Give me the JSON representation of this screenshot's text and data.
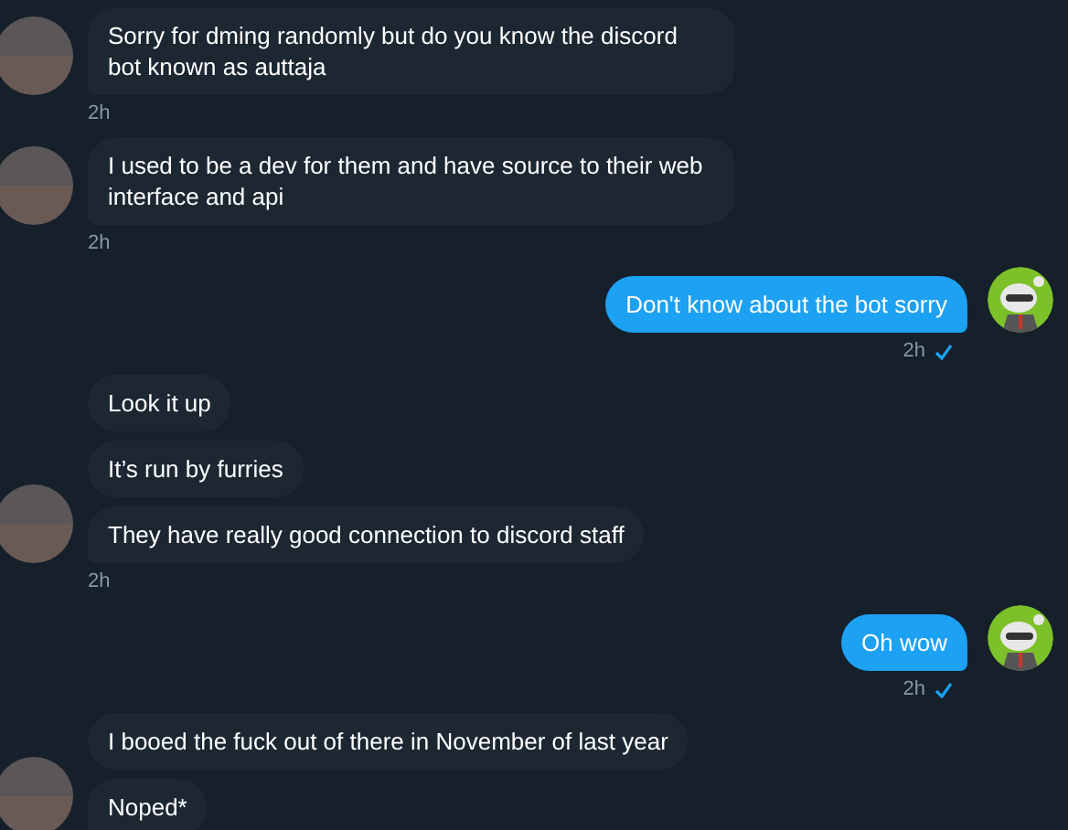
{
  "groups": [
    {
      "kind": "incoming",
      "messages": [
        "Sorry for dming randomly but do you know the discord bot known as auttaja"
      ],
      "time": "2h"
    },
    {
      "kind": "incoming",
      "messages": [
        "I used to be a dev for them and have source to their web interface and api"
      ],
      "time": "2h"
    },
    {
      "kind": "outgoing",
      "messages": [
        "Don't know about the bot sorry"
      ],
      "time": "2h",
      "read": true
    },
    {
      "kind": "incoming",
      "messages": [
        "Look it up",
        "It’s run by furries",
        "They have really good connection to discord staff"
      ],
      "time": "2h"
    },
    {
      "kind": "outgoing",
      "messages": [
        "Oh wow"
      ],
      "time": "2h",
      "read": true
    },
    {
      "kind": "incoming",
      "messages": [
        "I booed the fuck out of there in November of last year",
        "Noped*"
      ]
    }
  ]
}
